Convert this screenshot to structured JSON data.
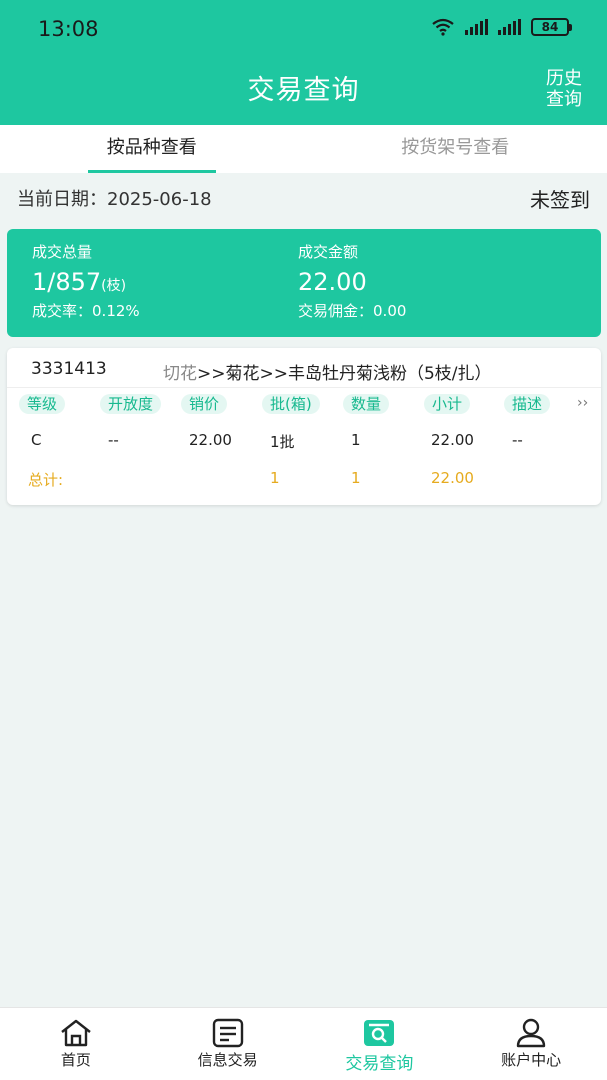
{
  "status_bar": {
    "time": "13:08",
    "battery": "84"
  },
  "header": {
    "title": "交易查询",
    "history_line1": "历史",
    "history_line2": "查询"
  },
  "tabs": [
    {
      "label": "按品种查看",
      "active": true
    },
    {
      "label": "按货架号查看",
      "active": false
    }
  ],
  "date_row": {
    "label": "当前日期：",
    "date": "2025-06-18",
    "sign_status": "未签到"
  },
  "summary": {
    "total_qty_label": "成交总量",
    "total_qty_value": "1/857",
    "total_qty_unit": "(枝)",
    "rate_label": "成交率：",
    "rate_value": "0.12%",
    "amount_label": "成交金额",
    "amount_value": "22.00",
    "commission_label": "交易佣金：",
    "commission_value": "0.00"
  },
  "product_card": {
    "code": "3331413",
    "category": "切花",
    "path": ">>菊花>>丰岛牡丹菊浅粉（5枝/扎）",
    "columns": [
      "等级",
      "开放度",
      "销价",
      "批(箱)",
      "数量",
      "小计",
      "描述"
    ],
    "more_icon": "double-chevron-right",
    "rows": [
      {
        "grade": "C",
        "openness": "--",
        "price": "22.00",
        "batches": "1批",
        "quantity": "1",
        "subtotal": "22.00",
        "desc": "--"
      }
    ],
    "total": {
      "label": "总计:",
      "batches": "1",
      "quantity": "1",
      "subtotal": "22.00"
    }
  },
  "bottom_nav": [
    {
      "label": "首页",
      "icon": "home-icon",
      "active": false
    },
    {
      "label": "信息交易",
      "icon": "document-icon",
      "active": false
    },
    {
      "label": "交易查询",
      "icon": "search-doc-icon",
      "active": true
    },
    {
      "label": "账户中心",
      "icon": "user-icon",
      "active": false
    }
  ],
  "colors": {
    "accent": "#1ec7a0",
    "total_text": "#e6ab1f",
    "background": "#eef4f3"
  }
}
